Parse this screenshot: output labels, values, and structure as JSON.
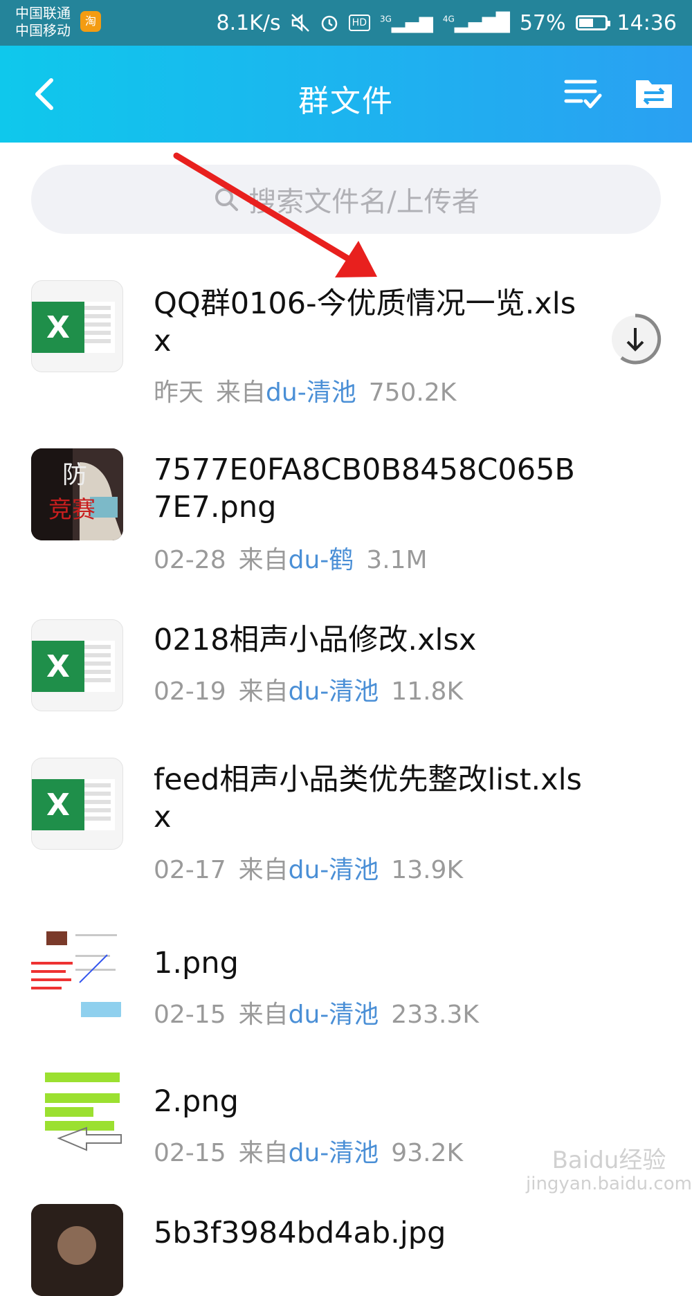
{
  "status_bar": {
    "carrier1": "中国联通",
    "carrier2": "中国移动",
    "app_badge": "淘",
    "speed": "8.1K/s",
    "hd": "HD",
    "net1": "3G",
    "net2": "4G",
    "battery": "57%",
    "time": "14:36"
  },
  "header": {
    "title": "群文件"
  },
  "search": {
    "placeholder": "搜索文件名/上传者"
  },
  "files": [
    {
      "name": "QQ群0106-今优质情况一览.xlsx",
      "date": "昨天",
      "from": "来自",
      "uploader": "du-清池",
      "size": "750.2K",
      "type": "excel"
    },
    {
      "name": "7577E0FA8CB0B8458C065B7E7.png",
      "date": "02-28",
      "from": "来自",
      "uploader": "du-鹤",
      "size": "3.1M",
      "type": "image"
    },
    {
      "name": "0218相声小品修改.xlsx",
      "date": "02-19",
      "from": "来自",
      "uploader": "du-清池",
      "size": "11.8K",
      "type": "excel"
    },
    {
      "name": "feed相声小品类优先整改list.xlsx",
      "date": "02-17",
      "from": "来自",
      "uploader": "du-清池",
      "size": "13.9K",
      "type": "excel"
    },
    {
      "name": "1.png",
      "date": "02-15",
      "from": "来自",
      "uploader": "du-清池",
      "size": "233.3K",
      "type": "image"
    },
    {
      "name": "2.png",
      "date": "02-15",
      "from": "来自",
      "uploader": "du-清池",
      "size": "93.2K",
      "type": "image"
    },
    {
      "name": "5b3f3984bd4ab.jpg",
      "type": "image"
    }
  ],
  "colors": {
    "header_start": "#0fc8ec",
    "header_end": "#2aa0f2",
    "uploader": "#4a8fd6",
    "excel_green": "#1f8f4a",
    "annotation_arrow": "#e8201e"
  },
  "watermark": {
    "line1": "Baidu经验",
    "line2": "jingyan.baidu.com"
  }
}
